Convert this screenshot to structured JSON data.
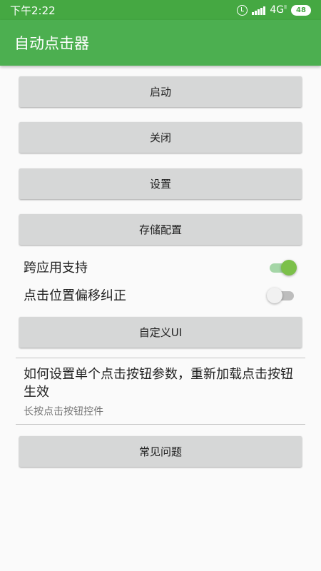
{
  "status_bar": {
    "time": "下午2:22",
    "network": "4G",
    "network_sup": "ll",
    "battery": "48"
  },
  "app_bar": {
    "title": "自动点击器"
  },
  "buttons": {
    "start": "启动",
    "close": "关闭",
    "settings": "设置",
    "save_config": "存储配置",
    "custom_ui": "自定义UI",
    "faq": "常见问题"
  },
  "switches": {
    "cross_app": {
      "label": "跨应用支持",
      "checked": true
    },
    "offset_correction": {
      "label": "点击位置偏移纠正",
      "checked": false
    }
  },
  "info": {
    "title": "如何设置单个点击按钮参数，重新加载点击按钮生效",
    "subtitle": "长按点击按钮控件"
  },
  "colors": {
    "primary": "#4caf50",
    "status_bar": "#45a842",
    "button": "#d6d7d7",
    "toggle_on": "#7cc04a"
  }
}
